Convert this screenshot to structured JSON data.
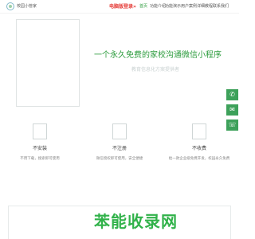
{
  "header": {
    "brand": "校园小管家",
    "pc_login": "电脑版登录»",
    "nav": [
      "首页",
      "功能介绍",
      "功能演示",
      "用户案例",
      "详细教程",
      "联系我们"
    ]
  },
  "hero": {
    "title": "一个永久免费的家校沟通微信小程序",
    "subtitle": "教育信息化方案提供者"
  },
  "float_buttons": [
    "✆",
    "✉",
    "☏"
  ],
  "features": [
    {
      "title": "不安装",
      "desc": "不用下载，搜索即可使用"
    },
    {
      "title": "不注册",
      "desc": "微信授权即可使用，安全便捷"
    },
    {
      "title": "不收费",
      "desc": "给一款企业级免费开发，校园永久免费"
    }
  ],
  "watermark": "苯能收录网"
}
